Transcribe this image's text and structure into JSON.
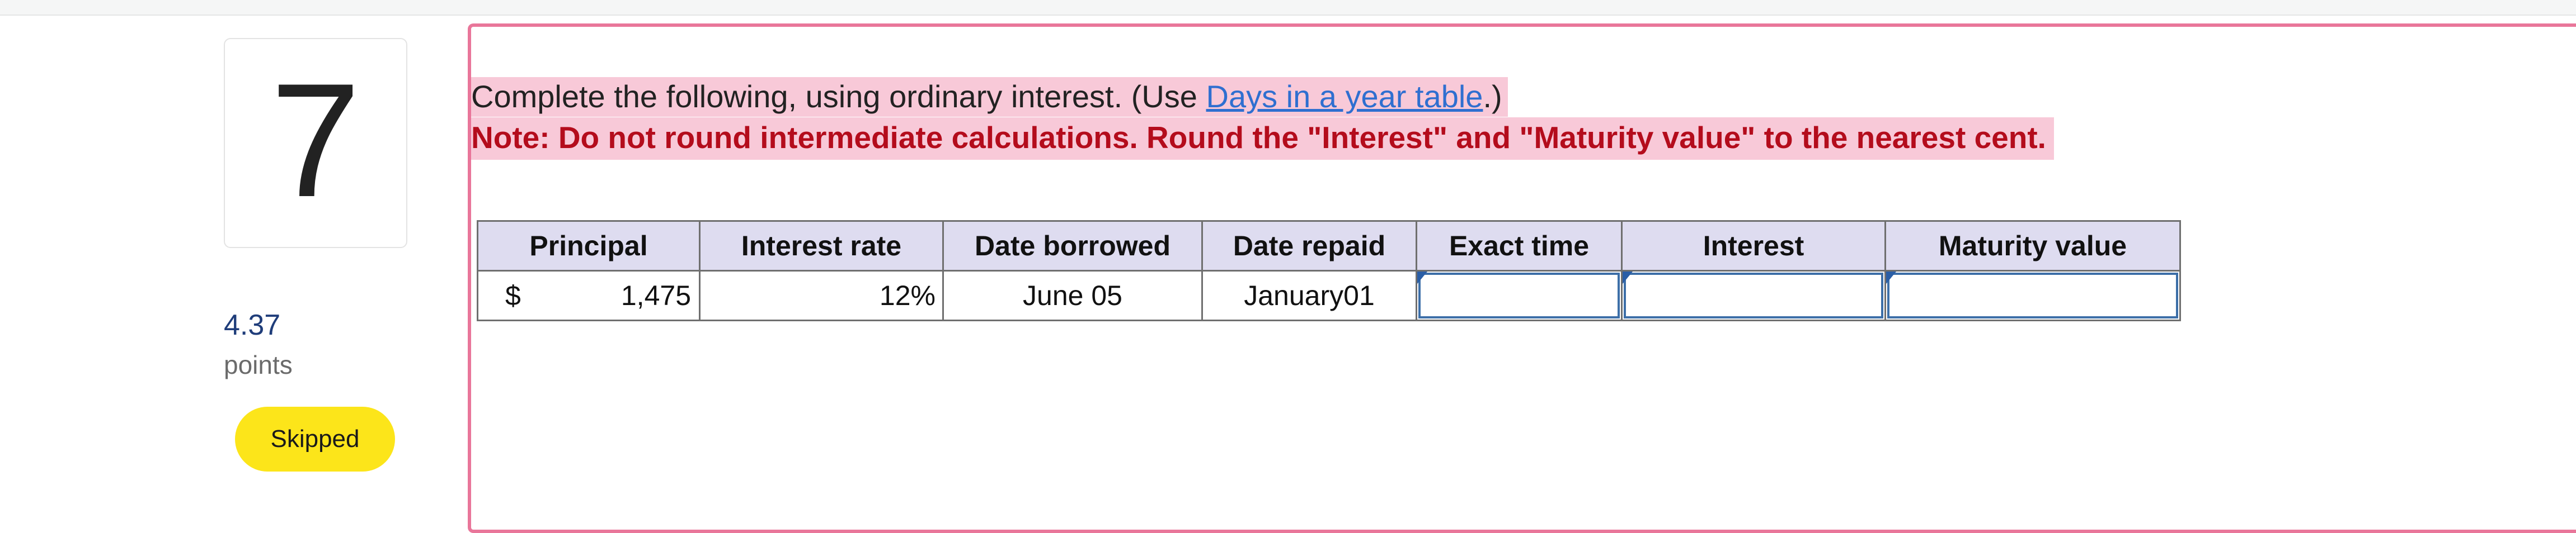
{
  "question": {
    "number": "7",
    "points_value": "4.37",
    "points_label": "points",
    "status": "Skipped"
  },
  "instructions": {
    "line1_before": "Complete the following, using ordinary interest. (Use ",
    "line1_link": "Days in a year table",
    "line1_after": ".)",
    "note": "Note: Do not round intermediate calculations. Round the \"Interest\" and \"Maturity value\" to the nearest cent."
  },
  "table": {
    "headers": [
      "Principal",
      "Interest rate",
      "Date borrowed",
      "Date repaid",
      "Exact time",
      "Interest",
      "Maturity value"
    ],
    "row": {
      "currency": "$",
      "principal": "1,475",
      "rate": "12%",
      "borrowed": "June 05",
      "repaid": "January01",
      "exact_time": "",
      "interest": "",
      "maturity_value": ""
    }
  },
  "colors": {
    "frame": "#e9769a",
    "highlight": "#f8c9d8",
    "note_text": "#b40c1c",
    "link": "#2f6fd0",
    "header_bg": "#dedcf0",
    "badge": "#fce51a"
  }
}
